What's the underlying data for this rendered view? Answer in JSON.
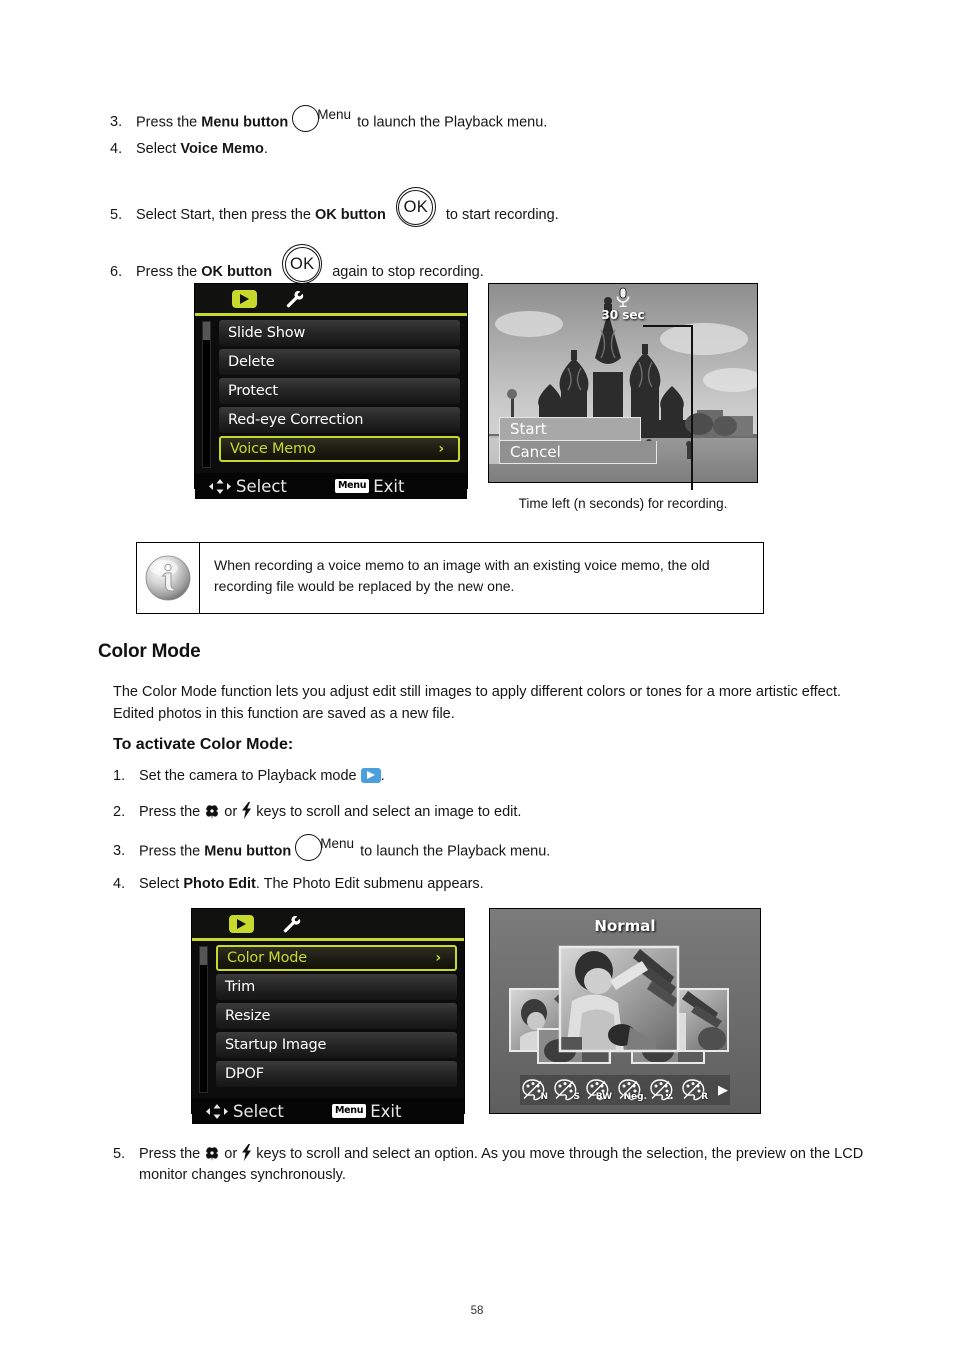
{
  "page": {
    "number": "58"
  },
  "voice_memo_steps": [
    {
      "num": "3.",
      "pre": "Press the ",
      "bold": "Menu button",
      "icon": "menu-button-icon",
      "icon_label": "Menu",
      "post": " to launch the Playback menu."
    },
    {
      "num": "4.",
      "pre": "Select ",
      "bold": "Voice Memo",
      "post": "."
    },
    {
      "num": "5.",
      "pre": "Select Start, then press the ",
      "bold": "OK button",
      "icon": "ok-button-icon",
      "icon_label": "OK",
      "post": " to start recording."
    },
    {
      "num": "6.",
      "pre": "Press the ",
      "bold": "OK button",
      "icon": "ok-button-icon",
      "icon_label": "OK",
      "post": " again to stop recording."
    }
  ],
  "playback_menu": {
    "tabs": [
      "playback-tab-icon",
      "setup-tab-icon"
    ],
    "items": [
      {
        "label": "Slide Show",
        "selected": false,
        "arrow": ""
      },
      {
        "label": "Delete",
        "selected": false,
        "arrow": ""
      },
      {
        "label": "Protect",
        "selected": false,
        "arrow": ""
      },
      {
        "label": "Red-eye Correction",
        "selected": false,
        "arrow": ""
      },
      {
        "label": "Voice Memo",
        "selected": true,
        "arrow": "›"
      }
    ],
    "footer": {
      "select_label": "Select",
      "menu_badge": "Menu",
      "exit_label": "Exit"
    }
  },
  "voice_memo_preview": {
    "mic_icon": "microphone-icon",
    "time_label": "30 sec",
    "options": [
      {
        "label": "Start",
        "selected": true
      },
      {
        "label": "Cancel",
        "selected": false
      }
    ],
    "caption": "Time left (n seconds) for recording."
  },
  "note": {
    "icon": "info-icon",
    "text": "When recording a voice memo to an image with an existing voice memo, the old recording file would be replaced by the new one."
  },
  "color_mode_section": {
    "title": "Color Mode",
    "paragraph": "The Color Mode function lets you adjust edit still images to apply different colors or tones for a more artistic effect. Edited photos in this function are saved as a new file.",
    "subtitle": "To activate Color Mode:",
    "steps": [
      {
        "num": "1.",
        "pre": "Set the camera to Playback mode ",
        "icon": "playback-mode-icon",
        "post": "."
      },
      {
        "num": "2.",
        "pre": "Press the ",
        "icon1": "macro-key-icon",
        "mid": " or ",
        "icon2": "flash-key-icon",
        "post": " keys to scroll and select an image to edit."
      },
      {
        "num": "3.",
        "pre": "Press the ",
        "bold": "Menu button",
        "icon": "menu-button-icon",
        "icon_label": "Menu",
        "post": " to launch the Playback menu."
      },
      {
        "num": "4.",
        "pre": "Select ",
        "bold": "Photo Edit",
        "post": ". The Photo Edit submenu appears."
      },
      {
        "num": "5.",
        "pre": "Press the ",
        "icon1": "macro-key-icon",
        "mid": " or ",
        "icon2": "flash-key-icon",
        "post": " keys to scroll and select an option. As you move through the selection, the preview on the LCD monitor changes synchronously."
      }
    ]
  },
  "photo_edit_menu": {
    "items": [
      {
        "label": "Color Mode",
        "selected": true,
        "arrow": "›"
      },
      {
        "label": "Trim",
        "selected": false,
        "arrow": ""
      },
      {
        "label": "Resize",
        "selected": false,
        "arrow": ""
      },
      {
        "label": "Startup Image",
        "selected": false,
        "arrow": ""
      },
      {
        "label": "DPOF",
        "selected": false,
        "arrow": ""
      }
    ],
    "footer": {
      "select_label": "Select",
      "menu_badge": "Menu",
      "exit_label": "Exit"
    }
  },
  "color_mode_preview": {
    "title": "Normal",
    "modes": [
      {
        "name": "normal-color-mode-icon",
        "label": "N"
      },
      {
        "name": "sepia-color-mode-icon",
        "label": "S"
      },
      {
        "name": "blackwhite-color-mode-icon",
        "label": "BW"
      },
      {
        "name": "negative-color-mode-icon",
        "label": "Neg."
      },
      {
        "name": "mosaic-color-mode-icon",
        "label": ""
      },
      {
        "name": "red-color-mode-icon",
        "label": "R"
      }
    ],
    "next_arrow": "▶"
  },
  "colors": {
    "accent": "#c7d92c",
    "playback_blue": "#4a9fdc",
    "lcd_bg": "#0c0c0c"
  }
}
